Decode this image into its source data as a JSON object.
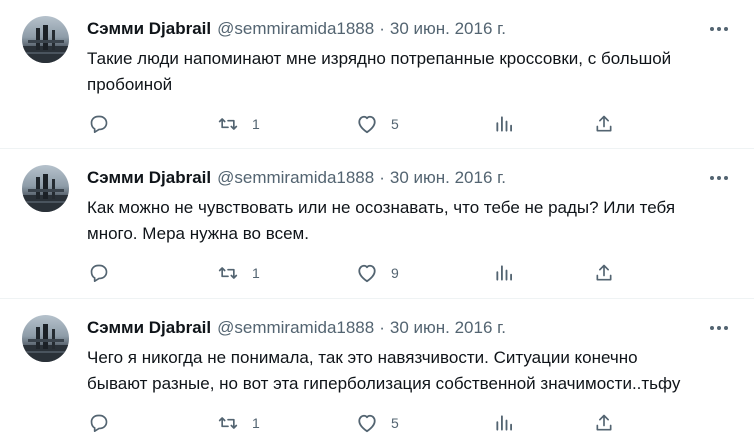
{
  "tweets": [
    {
      "author_name": "Сэмми Djabrail",
      "handle": "@semmiramida1888",
      "separator": "·",
      "date": "30 июн. 2016 г.",
      "text_lines": [
        "Такие люди напоминают мне изрядно потрепанные кроссовки, с большой",
        "пробоиной"
      ],
      "reply_count": "",
      "retweet_count": "1",
      "like_count": "5"
    },
    {
      "author_name": "Сэмми Djabrail",
      "handle": "@semmiramida1888",
      "separator": "·",
      "date": "30 июн. 2016 г.",
      "text_lines": [
        "Как можно не чувствовать или не осознавать, что тебе не рады? Или тебя",
        "много. Мера нужна во всем."
      ],
      "reply_count": "",
      "retweet_count": "1",
      "like_count": "9"
    },
    {
      "author_name": "Сэмми Djabrail",
      "handle": "@semmiramida1888",
      "separator": "·",
      "date": "30 июн. 2016 г.",
      "text_lines": [
        "Чего я никогда не понимала, так это навязчивости. Ситуации конечно",
        "бывают разные, но вот эта гиперболизация собственной значимости..тьфу"
      ],
      "reply_count": "",
      "retweet_count": "1",
      "like_count": "5"
    }
  ],
  "icons": {
    "more": "more-dots-icon",
    "reply": "reply-icon",
    "retweet": "retweet-icon",
    "like": "heart-icon",
    "views": "views-chart-icon",
    "share": "share-icon"
  },
  "colors": {
    "text": "#0f1419",
    "secondary": "#536471",
    "divider": "#eff3f4"
  }
}
